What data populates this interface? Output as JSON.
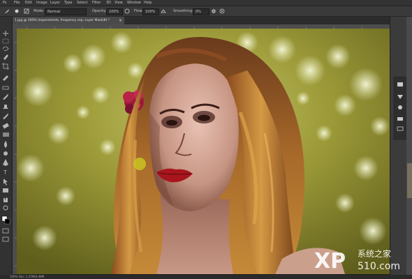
{
  "menubar": {
    "items": [
      "File",
      "Edit",
      "Image",
      "Layer",
      "Type",
      "Select",
      "Filter",
      "3D",
      "View",
      "Window",
      "Help"
    ]
  },
  "options": {
    "mode_label": "Mode:",
    "mode_value": "Normal",
    "opacity_label": "Opacity:",
    "opacity_value": "100%",
    "flow_label": "Flow:",
    "flow_value": "100%",
    "smoothing_label": "Smoothing:",
    "smoothing_value": "0%"
  },
  "document": {
    "tab_label": "1.jpg @ 100% (experiments, frequency sep, Layer Mask/8) *",
    "close_glyph": "×"
  },
  "status": {
    "text": "100%   Doc: 1.37M/4.48M"
  },
  "watermark": {
    "brand": "XP",
    "cn_text": "系统之家",
    "domain": "510.com"
  },
  "colors": {
    "accent": "#e8e8e8",
    "background": "#1f1f1f"
  }
}
